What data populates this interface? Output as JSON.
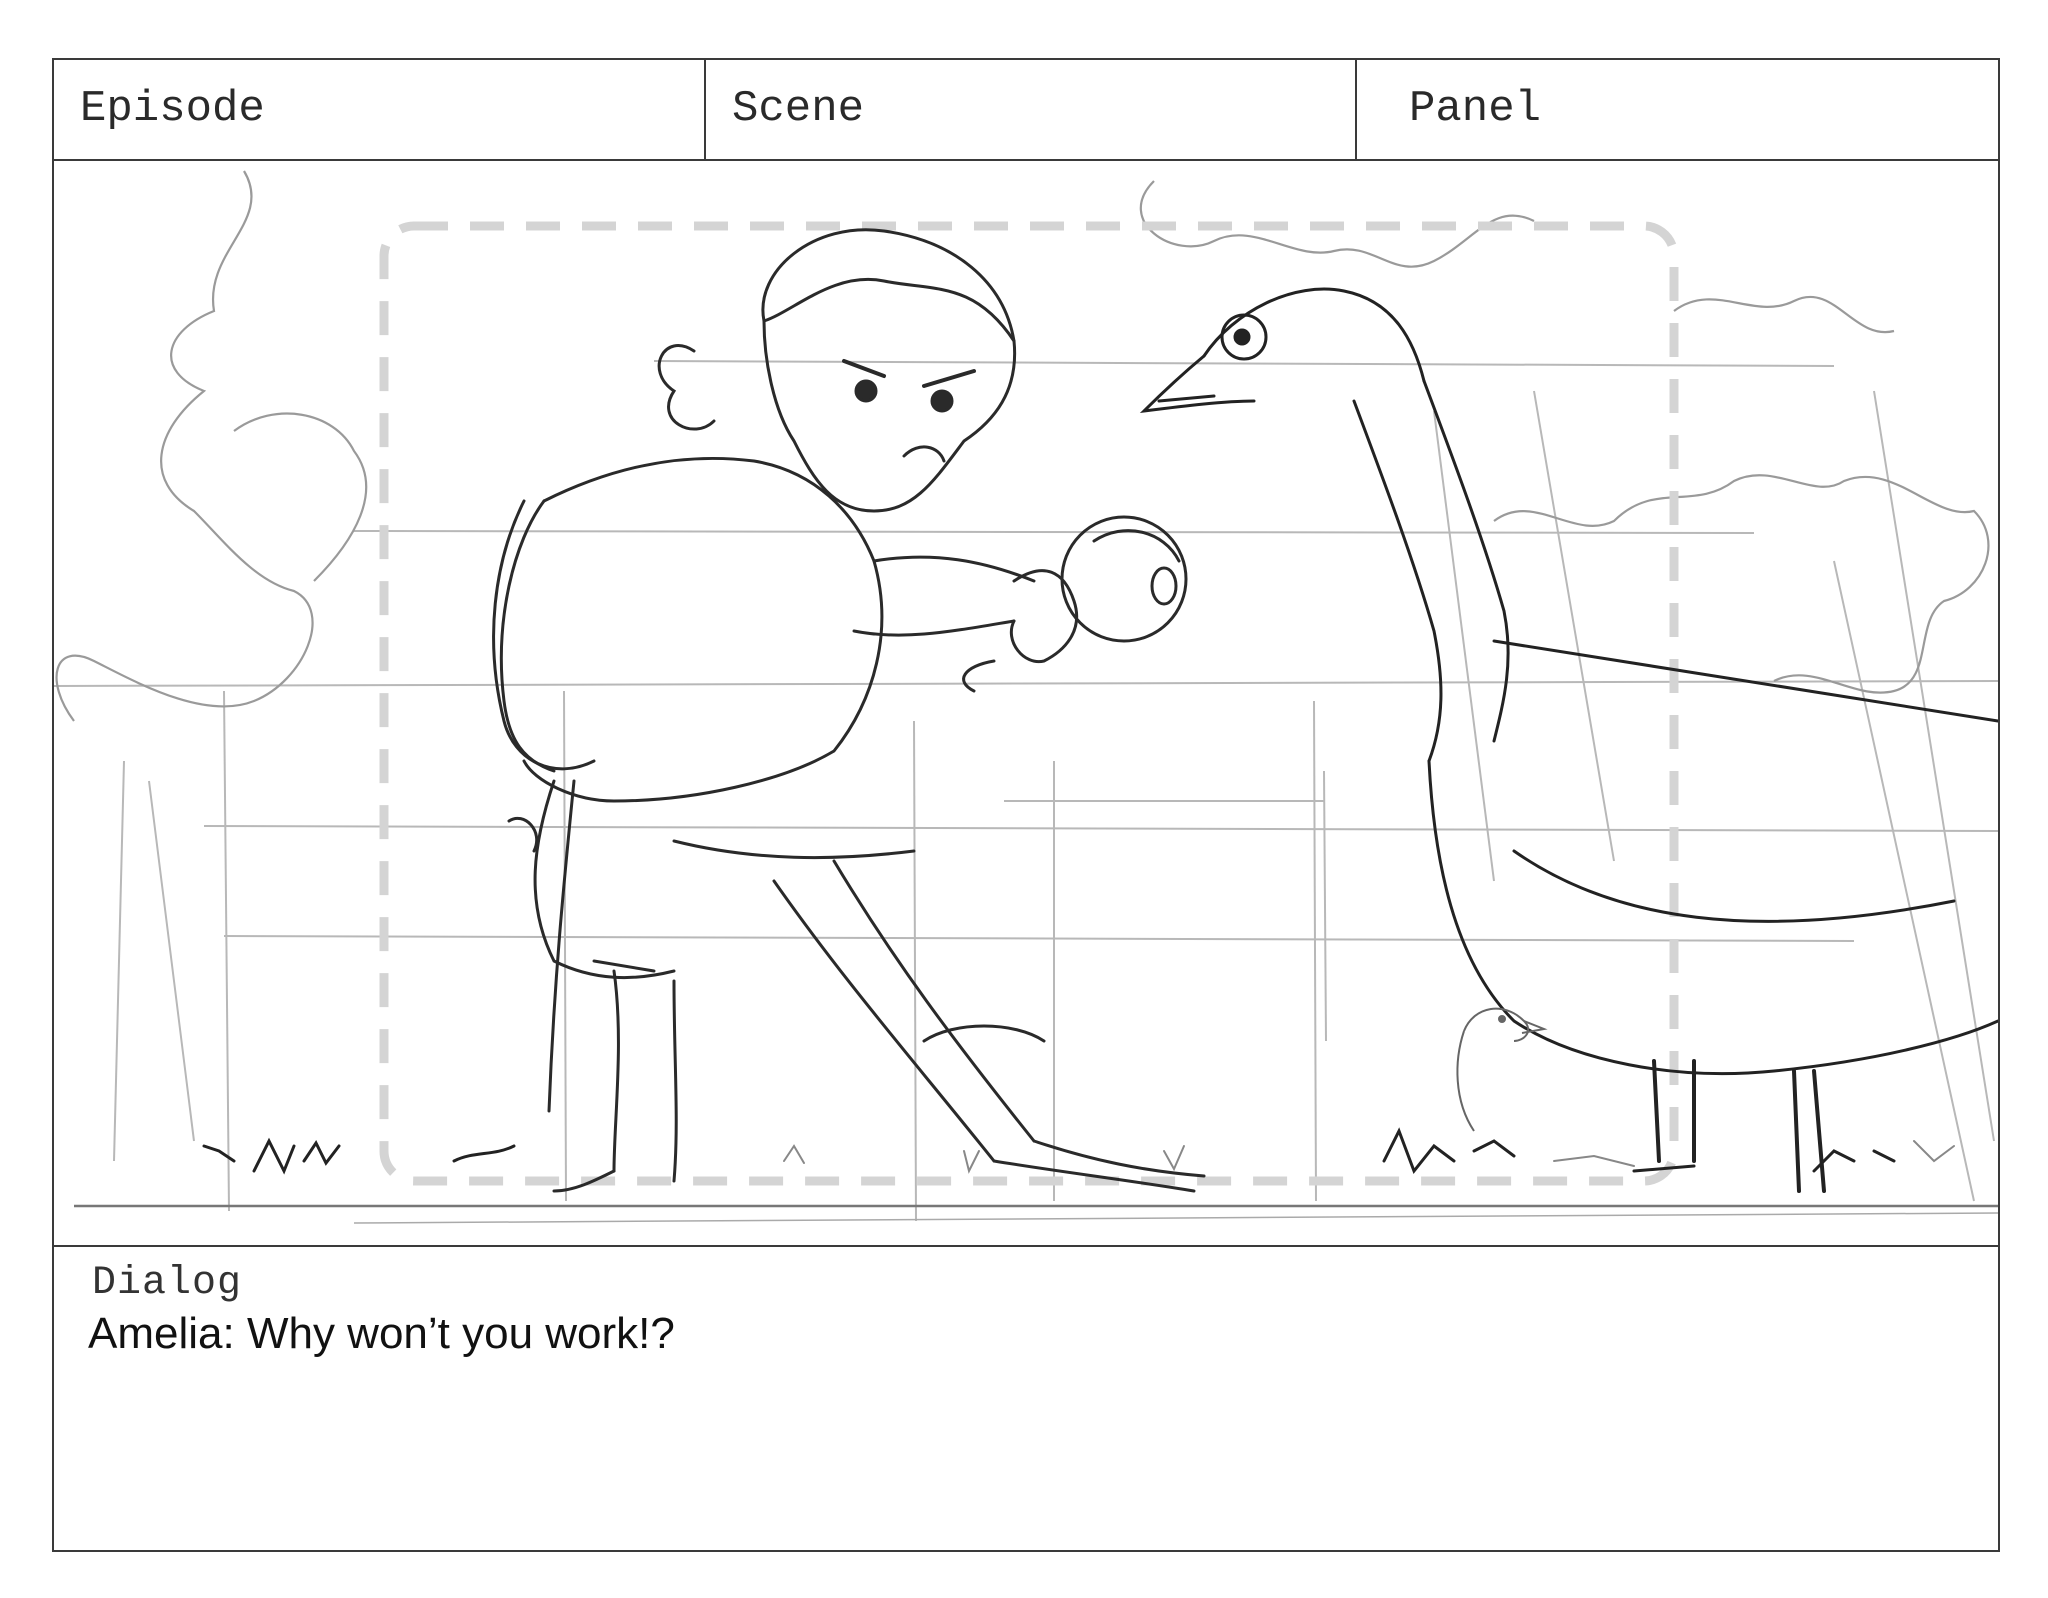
{
  "header": {
    "episode_label": "Episode",
    "scene_label": "Scene",
    "panel_label": "Panel"
  },
  "frame": {
    "description_name": "storyboard-sketch"
  },
  "dialog": {
    "title": "Dialog",
    "line": "Amelia: Why won’t you work!?"
  }
}
